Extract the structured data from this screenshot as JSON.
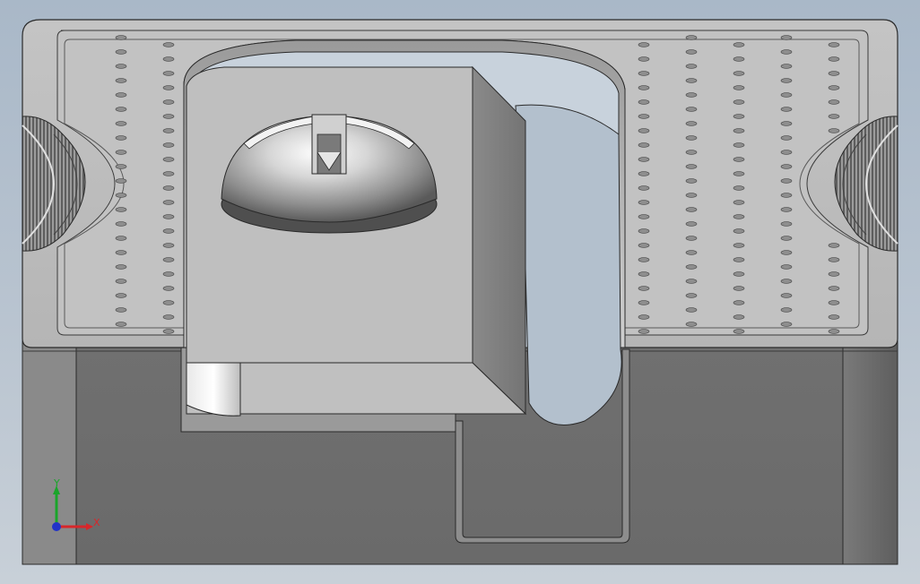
{
  "viewport": {
    "view_type": "cad-3d-viewport",
    "background_top": "#a9b8c8",
    "background_bottom": "#c8d0d8"
  },
  "triad": {
    "y_label": "Y",
    "x_label": "X",
    "y_color": "#1aa52a",
    "x_color": "#d8262a",
    "z_color": "#2233c8"
  },
  "part": {
    "top_face_color": "#bdbdbd",
    "front_face_color": "#6d6d6d",
    "hole_pattern": "oval-perforations",
    "dome_feature": "slotted-hemisphere"
  }
}
